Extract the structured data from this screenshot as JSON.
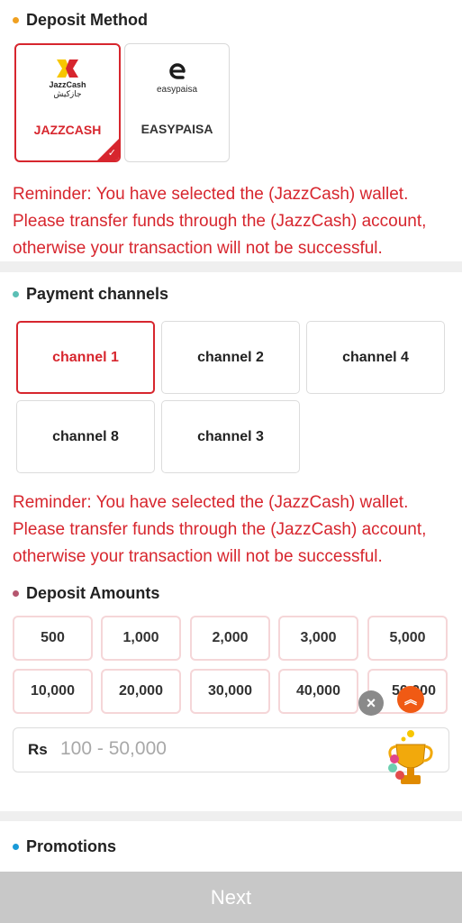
{
  "deposit_method": {
    "title": "Deposit Method",
    "dot_color": "#f0a020",
    "methods": [
      {
        "name": "JAZZCASH",
        "logo_text": "JazzCash",
        "logo_subtext": "جازکیش",
        "selected": true
      },
      {
        "name": "EASYPAISA",
        "logo_text": "easypaisa",
        "selected": false
      }
    ],
    "reminder_lines": [
      "Reminder: You have selected the (JazzCash) wallet.",
      "Please transfer funds through the (JazzCash) account,",
      "otherwise your transaction will not be successful."
    ]
  },
  "payment_channels": {
    "title": "Payment channels",
    "dot_color": "#5bbfb5",
    "channels": [
      {
        "label": "channel 1",
        "selected": true
      },
      {
        "label": "channel 2",
        "selected": false
      },
      {
        "label": "channel 4",
        "selected": false
      },
      {
        "label": "channel 8",
        "selected": false
      },
      {
        "label": "channel 3",
        "selected": false
      }
    ],
    "reminder_lines": [
      "Reminder: You have selected the (JazzCash) wallet.",
      "Please transfer funds through the (JazzCash) account,",
      "otherwise your transaction will not be successful."
    ]
  },
  "deposit_amounts": {
    "title": "Deposit Amounts",
    "dot_color": "#b5566f",
    "amounts": [
      "500",
      "1,000",
      "2,000",
      "3,000",
      "5,000",
      "10,000",
      "20,000",
      "30,000",
      "40,000",
      "50,000"
    ],
    "input": {
      "currency": "Rs",
      "placeholder": "100 - 50,000"
    }
  },
  "promotions": {
    "title": "Promotions",
    "dot_color": "#1a9ad8"
  },
  "overlay": {
    "close_icon": "×",
    "scroll_up_icon": "︽"
  },
  "next_button": {
    "label": "Next"
  },
  "colors": {
    "accent_red": "#d7262e",
    "disabled_gray": "#c8c8c8",
    "scroll_up_orange": "#f05a14"
  }
}
